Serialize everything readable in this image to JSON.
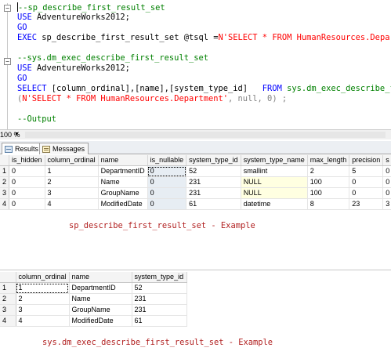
{
  "editor": {
    "lines": {
      "l1": "--sp_describe_first_result_set",
      "l2_kw": "USE",
      "l2_rest": " AdventureWorks2012;",
      "l3": "GO",
      "l4_exec": "EXEC",
      "l4_proc": " sp_describe_first_result_set ",
      "l4_param": "@tsql =",
      "l4_str": "N'SELECT * FROM HumanResources.Department'",
      "l6": "--sys.dm_exec_describe_first_result_set",
      "l7_kw": "USE",
      "l7_rest": " AdventureWorks2012;",
      "l8": "GO",
      "l9_kw": "SELECT",
      "l9_cols": " [column_ordinal],[name],[system_type_id]",
      "l9_from": "   FROM ",
      "l9_sys": "sys.dm_exec_describe_first_result_set",
      "l10_open": "(",
      "l10_str": "N'SELECT * FROM HumanResources.Department'",
      "l10_rest": ", null, 0) ;",
      "l12": "--Output"
    }
  },
  "zoom": {
    "level": "100 %"
  },
  "tabs": {
    "results": "Results",
    "messages": "Messages"
  },
  "grid1": {
    "headers": [
      "is_hidden",
      "column_ordinal",
      "name",
      "is_nullable",
      "system_type_id",
      "system_type_name",
      "max_length",
      "precision",
      "s"
    ],
    "rows": [
      [
        "1",
        "0",
        "1",
        "DepartmentID",
        "0",
        "52",
        "smallint",
        "2",
        "5",
        "0"
      ],
      [
        "2",
        "0",
        "2",
        "Name",
        "0",
        "231",
        "NULL",
        "100",
        "0",
        "0"
      ],
      [
        "3",
        "0",
        "3",
        "GroupName",
        "0",
        "231",
        "NULL",
        "100",
        "0",
        "0"
      ],
      [
        "4",
        "0",
        "4",
        "ModifiedDate",
        "0",
        "61",
        "datetime",
        "8",
        "23",
        "3"
      ]
    ]
  },
  "caption1": "sp_describe_first_result_set - Example",
  "grid2": {
    "headers": [
      "column_ordinal",
      "name",
      "system_type_id"
    ],
    "rows": [
      [
        "1",
        "1",
        "DepartmentID",
        "52"
      ],
      [
        "2",
        "2",
        "Name",
        "231"
      ],
      [
        "3",
        "3",
        "GroupName",
        "231"
      ],
      [
        "4",
        "4",
        "ModifiedDate",
        "61"
      ]
    ]
  },
  "caption2": "sys.dm_exec_describe_first_result_set - Example"
}
